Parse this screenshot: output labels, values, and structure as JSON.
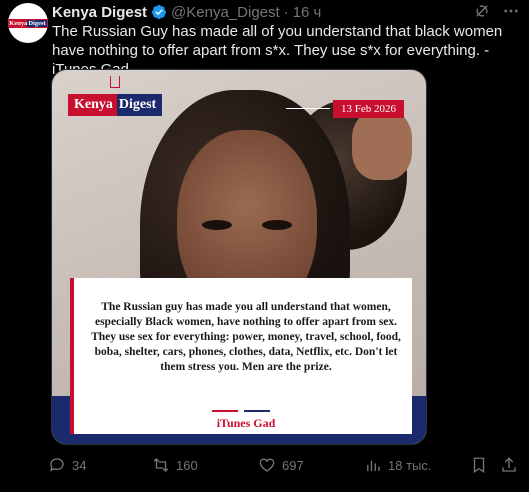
{
  "account": {
    "name": "Kenya Digest",
    "handle": "@Kenya_Digest",
    "separator": "·",
    "time": "16 ч",
    "avatar_text_1": "Kenya",
    "avatar_text_2": "Digest"
  },
  "tweet": {
    "text": "The Russian Guy has made all of you understand that black women have nothing to offer apart from s*x. They use s*x for everything. - iTunes Gad"
  },
  "media": {
    "brand_word_1": "Kenya",
    "brand_word_2": "Digest",
    "date": "13 Feb 2026",
    "quote": "The Russian guy has made you all understand that women, especially Black women, have nothing to offer apart from sex. They use sex for everything: power, money, travel, school, food, boba, shelter, cars, phones, clothes, data, Netflix, etc. Don't let them stress you. Men are the prize.",
    "author": "iTunes Gad"
  },
  "actions": {
    "replies": "34",
    "reposts": "160",
    "likes": "697",
    "views": "18 тыс."
  },
  "icons": {
    "verified": "verified-badge-icon",
    "grok": "grok-icon",
    "more": "more-icon",
    "reply": "reply-icon",
    "repost": "repost-icon",
    "like": "heart-icon",
    "views": "views-icon",
    "share": "share-icon"
  },
  "colors": {
    "background": "#000000",
    "text": "#e7e9ea",
    "muted": "#71767b",
    "verified": "#1d9bf0",
    "brand_red": "#c8102e",
    "brand_blue": "#1a2a6c"
  }
}
